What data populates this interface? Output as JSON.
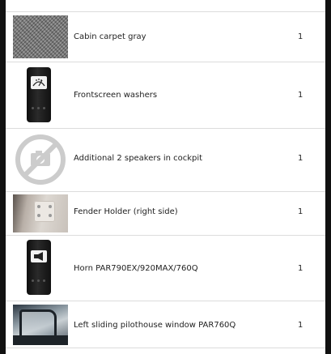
{
  "items": [
    {
      "name": "Cabin carpet gray",
      "qty": "1",
      "image_icon": "carpet-photo"
    },
    {
      "name": "Frontscreen washers",
      "qty": "1",
      "image_icon": "washer-switch-photo"
    },
    {
      "name": "Additional 2 speakers in cockpit",
      "qty": "1",
      "image_icon": "no-image-placeholder"
    },
    {
      "name": "Fender Holder (right side)",
      "qty": "1",
      "image_icon": "fender-holder-photo"
    },
    {
      "name": "Horn PAR790EX/920MAX/760Q",
      "qty": "1",
      "image_icon": "horn-switch-photo"
    },
    {
      "name": "Left sliding pilothouse window PAR760Q",
      "qty": "1",
      "image_icon": "window-photo"
    }
  ]
}
